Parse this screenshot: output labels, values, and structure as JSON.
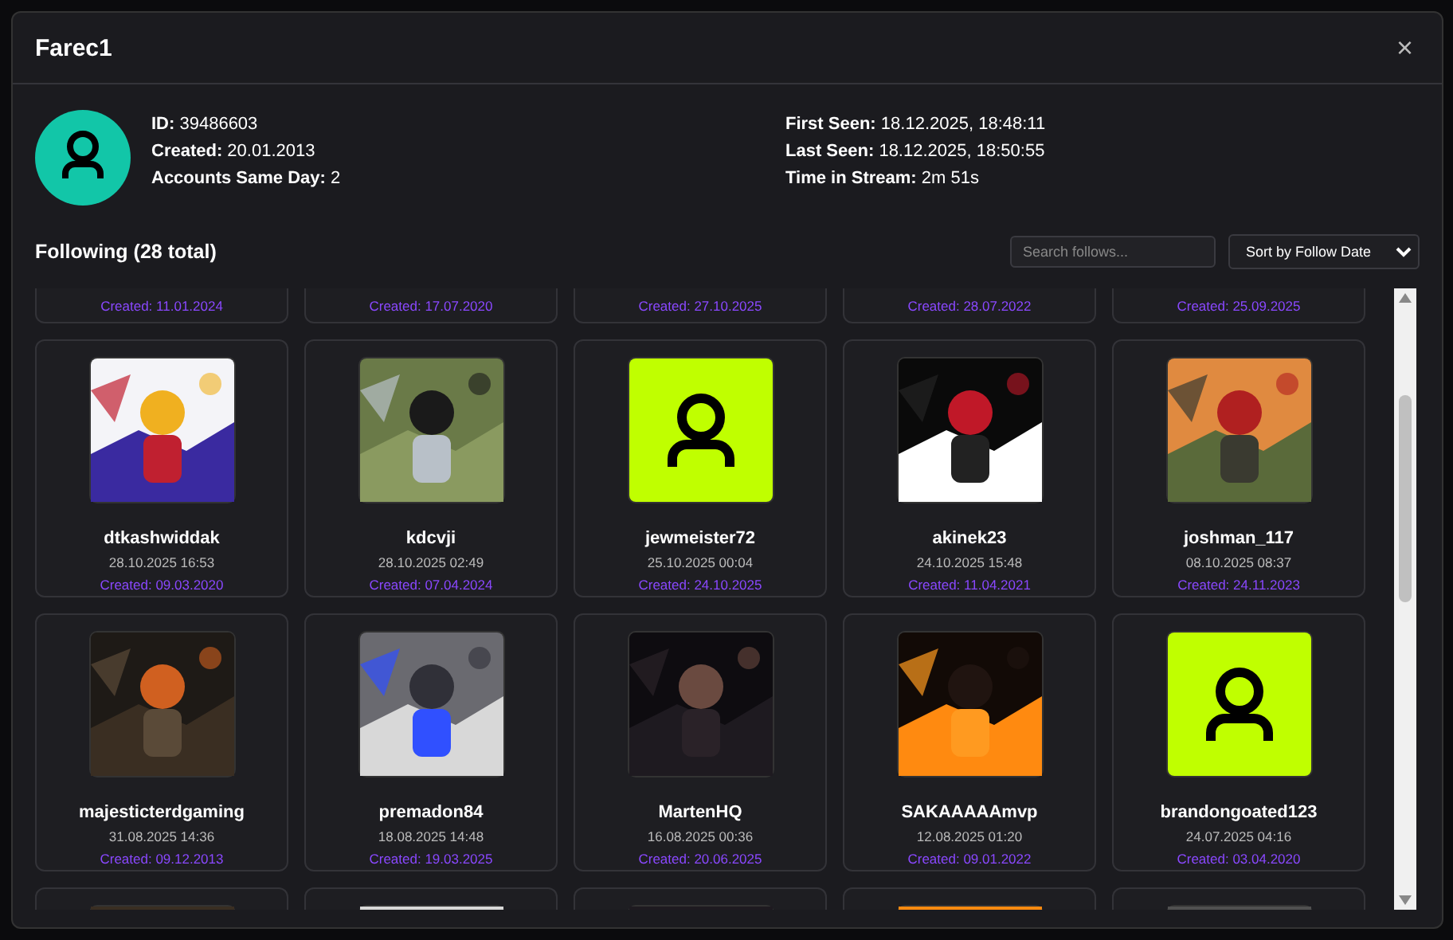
{
  "modal": {
    "title": "Farec1",
    "close": "×"
  },
  "profile": {
    "avatar": {
      "kind": "default"
    },
    "left": [
      {
        "label": "ID:",
        "value": "39486603"
      },
      {
        "label": "Created:",
        "value": "20.01.2013"
      },
      {
        "label": "Accounts Same Day:",
        "value": "2"
      }
    ],
    "right": [
      {
        "label": "First Seen:",
        "value": "18.12.2025, 18:48:11"
      },
      {
        "label": "Last Seen:",
        "value": "18.12.2025, 18:50:55"
      },
      {
        "label": "Time in Stream:",
        "value": "2m 51s"
      }
    ]
  },
  "following": {
    "heading": "Following (28 total)",
    "search": {
      "placeholder": "Search follows..."
    },
    "sort": {
      "value": "Sort by Follow Date"
    },
    "partial_top": [
      "Created: 11.01.2024",
      "Created: 17.07.2020",
      "Created: 27.10.2025",
      "Created: 28.07.2022",
      "Created: 25.09.2025"
    ],
    "cards": [
      {
        "name": "dtkashwiddak",
        "followed": "28.10.2025 16:53",
        "created": "Created: 09.03.2020"
      },
      {
        "name": "kdcvji",
        "followed": "28.10.2025 02:49",
        "created": "Created: 07.04.2024"
      },
      {
        "avatar": {
          "kind": "default"
        },
        "name": "jewmeister72",
        "followed": "25.10.2025 00:04",
        "created": "Created: 24.10.2025"
      },
      {
        "name": "akinek23",
        "followed": "24.10.2025 15:48",
        "created": "Created: 11.04.2021"
      },
      {
        "name": "joshman_117",
        "followed": "08.10.2025 08:37",
        "created": "Created: 24.11.2023"
      },
      {
        "name": "majesticterdgaming",
        "followed": "31.08.2025 14:36",
        "created": "Created: 09.12.2013"
      },
      {
        "name": "premadon84",
        "followed": "18.08.2025 14:48",
        "created": "Created: 19.03.2025"
      },
      {
        "name": "MartenHQ",
        "followed": "16.08.2025 00:36",
        "created": "Created: 20.06.2025"
      },
      {
        "name": "SAKAAAAAmvp",
        "followed": "12.08.2025 01:20",
        "created": "Created: 09.01.2022"
      },
      {
        "avatar": {
          "kind": "default"
        },
        "name": "brandongoated123",
        "followed": "24.07.2025 04:16",
        "created": "Created: 03.04.2020"
      }
    ]
  }
}
